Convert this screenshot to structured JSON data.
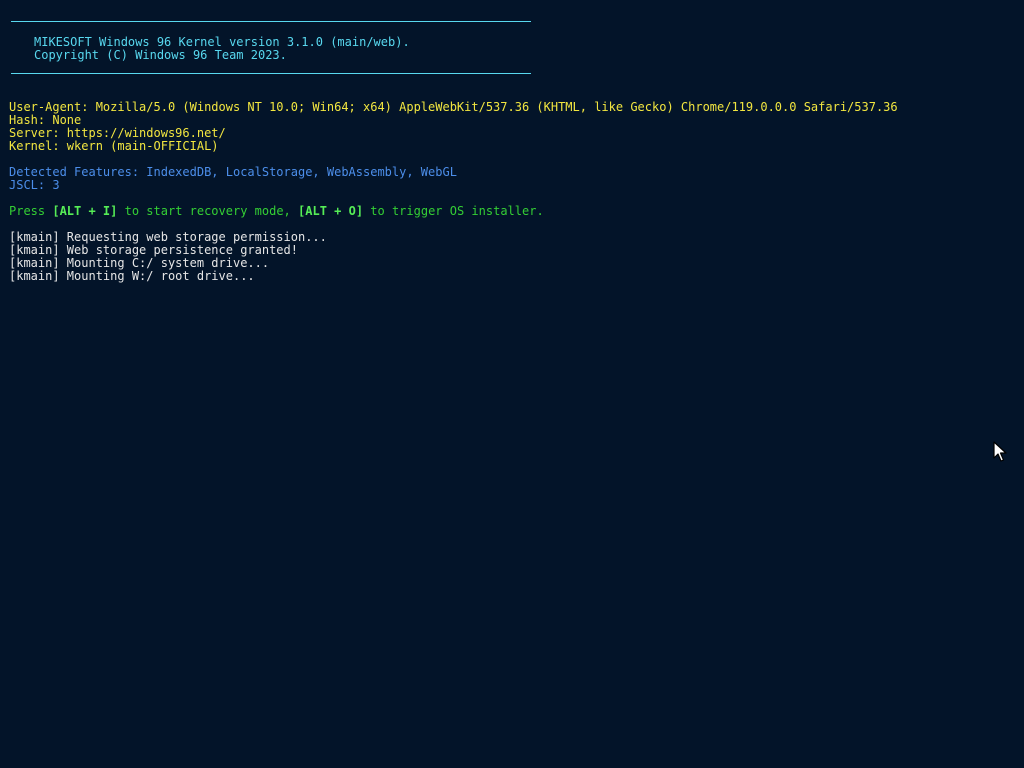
{
  "banner": {
    "line1": "MIKESOFT Windows 96 Kernel version 3.1.0 (main/web).",
    "line2": "Copyright (C) Windows 96 Team 2023."
  },
  "system_info": {
    "user_agent": "User-Agent: Mozilla/5.0 (Windows NT 10.0; Win64; x64) AppleWebKit/537.36 (KHTML, like Gecko) Chrome/119.0.0.0 Safari/537.36",
    "hash": "Hash: None",
    "server": "Server: https://windows96.net/",
    "kernel": "Kernel: wkern (main-OFFICIAL)"
  },
  "features": {
    "detected": "Detected Features: IndexedDB, LocalStorage, WebAssembly, WebGL",
    "jscl": "JSCL: 3"
  },
  "prompt": {
    "press": "Press ",
    "recovery_key": "[ALT + I]",
    "recovery_text": " to start recovery mode, ",
    "installer_key": "[ALT + O]",
    "installer_text": " to trigger OS installer."
  },
  "log": [
    "[kmain] Requesting web storage permission...",
    "[kmain] Web storage persistence granted!",
    "[kmain] Mounting C:/ system drive...",
    "[kmain] Mounting W:/ root drive..."
  ],
  "colors": {
    "background": "#031429",
    "banner": "#58d8ef",
    "info": "#f2e640",
    "features": "#4c8eea",
    "prompt": "#34cf34",
    "log": "#e6e6e6"
  },
  "icons": {
    "cursor": "mouse-pointer-icon"
  }
}
